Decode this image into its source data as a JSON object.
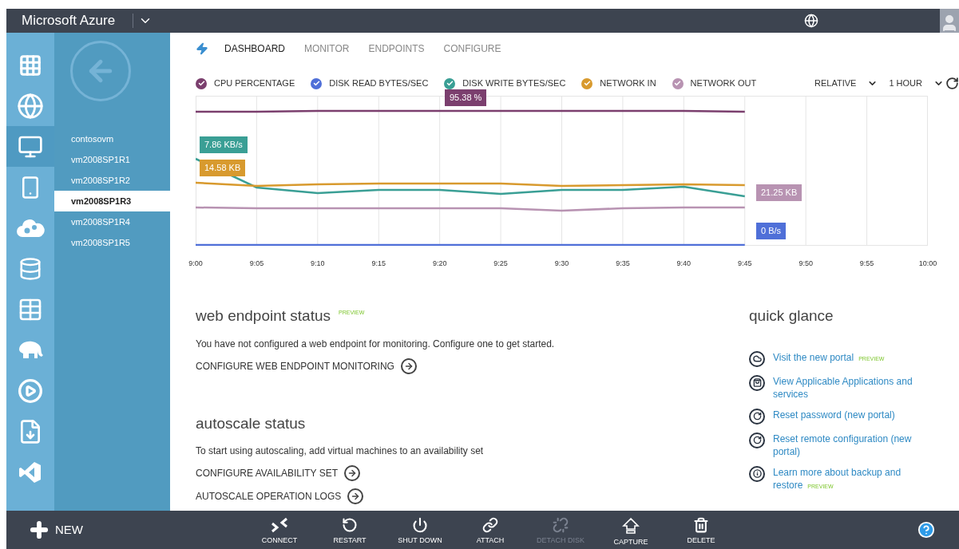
{
  "top_bar": {
    "title": "Microsoft Azure"
  },
  "nav_icons": [
    {
      "selected": false
    },
    {
      "selected": false
    },
    {
      "selected": true
    },
    {
      "selected": false
    },
    {
      "selected": false
    },
    {
      "selected": false
    },
    {
      "selected": false
    },
    {
      "selected": false
    },
    {
      "selected": false
    },
    {
      "selected": false
    },
    {
      "selected": false
    }
  ],
  "vm_list": [
    {
      "name": "contosovm",
      "selected": false
    },
    {
      "name": "vm2008SP1R1",
      "selected": false
    },
    {
      "name": "vm2008SP1R2",
      "selected": false
    },
    {
      "name": "vm2008SP1R3",
      "selected": true
    },
    {
      "name": "vm2008SP1R4",
      "selected": false
    },
    {
      "name": "vm2008SP1R5",
      "selected": false
    }
  ],
  "tabs": [
    {
      "label": "DASHBOARD",
      "selected": true
    },
    {
      "label": "MONITOR",
      "selected": false
    },
    {
      "label": "ENDPOINTS",
      "selected": false
    },
    {
      "label": "CONFIGURE",
      "selected": false
    }
  ],
  "legend": [
    {
      "label": "CPU PERCENTAGE",
      "color": "#7b3f6e",
      "checked": true
    },
    {
      "label": "DISK READ BYTES/SEC",
      "color": "#4f6fd8",
      "checked": true
    },
    {
      "label": "DISK WRITE BYTES/SEC",
      "color": "#3a9f95",
      "checked": true
    },
    {
      "label": "NETWORK IN",
      "color": "#d89a2e",
      "checked": true
    },
    {
      "label": "NETWORK OUT",
      "color": "#b893b2",
      "checked": true
    }
  ],
  "range": {
    "mode": "RELATIVE",
    "period": "1 HOUR"
  },
  "callouts": [
    {
      "text": "95.38 %",
      "color": "#7b3f6e"
    },
    {
      "text": "7.86 KB/s",
      "color": "#3a9f95"
    },
    {
      "text": "14.58 KB",
      "color": "#d89a2e"
    },
    {
      "text": "21.25 KB",
      "color": "#b893b2"
    },
    {
      "text": "0 B/s",
      "color": "#4f6fd8"
    }
  ],
  "x_labels": [
    "9:00",
    "9:05",
    "9:10",
    "9:15",
    "9:20",
    "9:25",
    "9:30",
    "9:35",
    "9:40",
    "9:45",
    "9:50",
    "9:55",
    "10:00"
  ],
  "web_endpoint": {
    "heading": "web endpoint status",
    "badge": "PREVIEW",
    "text": "You have not configured a web endpoint for monitoring. Configure one to get started.",
    "links": [
      "CONFIGURE WEB ENDPOINT MONITORING"
    ]
  },
  "autoscale": {
    "heading": "autoscale status",
    "text": "To start using autoscaling, add virtual machines to an availability set",
    "links": [
      "CONFIGURE AVAILABILITY SET",
      "AUTOSCALE OPERATION LOGS"
    ]
  },
  "quick_glance": {
    "heading": "quick glance",
    "links": [
      {
        "text": "Visit the new portal",
        "badge": "PREVIEW"
      },
      {
        "text": "View Applicable Applications and services"
      },
      {
        "text": "Reset password (new portal)"
      },
      {
        "text": "Reset remote configuration (new portal)"
      },
      {
        "text": "Learn more about backup and restore",
        "badge": "PREVIEW"
      }
    ]
  },
  "command_bar": {
    "new_label": "NEW",
    "commands": [
      {
        "label": "CONNECT",
        "disabled": false
      },
      {
        "label": "RESTART",
        "disabled": false
      },
      {
        "label": "SHUT DOWN",
        "disabled": false
      },
      {
        "label": "ATTACH",
        "disabled": false
      },
      {
        "label": "DETACH DISK",
        "disabled": true
      },
      {
        "label": "CAPTURE",
        "disabled": false
      },
      {
        "label": "DELETE",
        "disabled": false
      }
    ]
  }
}
